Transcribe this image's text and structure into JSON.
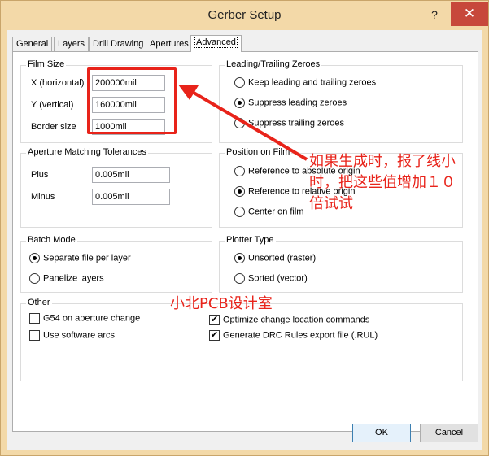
{
  "window": {
    "title": "Gerber Setup",
    "help_label": "?",
    "close_label": "✕"
  },
  "tabs": [
    {
      "label": "General"
    },
    {
      "label": "Layers"
    },
    {
      "label": "Drill Drawing"
    },
    {
      "label": "Apertures"
    },
    {
      "label": "Advanced"
    }
  ],
  "film_size": {
    "label": "Film Size",
    "x_label": "X (horizontal)",
    "x_value": "200000mil",
    "y_label": "Y (vertical)",
    "y_value": "160000mil",
    "border_label": "Border size",
    "border_value": "1000mil"
  },
  "zeroes": {
    "label": "Leading/Trailing Zeroes",
    "options": [
      {
        "label": "Keep leading and trailing zeroes",
        "checked": false
      },
      {
        "label": "Suppress leading zeroes",
        "checked": true
      },
      {
        "label": "Suppress trailing zeroes",
        "checked": false
      }
    ]
  },
  "aperture_tolerances": {
    "label": "Aperture Matching Tolerances",
    "plus_label": "Plus",
    "plus_value": "0.005mil",
    "minus_label": "Minus",
    "minus_value": "0.005mil"
  },
  "position": {
    "label": "Position on Film",
    "options": [
      {
        "label": "Reference to absolute origin",
        "checked": false
      },
      {
        "label": "Reference to relative origin",
        "checked": true
      },
      {
        "label": "Center on film",
        "checked": false
      }
    ]
  },
  "batch": {
    "label": "Batch Mode",
    "options": [
      {
        "label": "Separate file per layer",
        "checked": true
      },
      {
        "label": "Panelize layers",
        "checked": false
      }
    ]
  },
  "plotter": {
    "label": "Plotter Type",
    "options": [
      {
        "label": "Unsorted (raster)",
        "checked": true
      },
      {
        "label": "Sorted (vector)",
        "checked": false
      }
    ]
  },
  "other": {
    "label": "Other",
    "g54": {
      "label": "G54 on aperture change",
      "checked": false
    },
    "arcs": {
      "label": "Use software arcs",
      "checked": false
    },
    "optimize": {
      "label": "Optimize change location commands",
      "checked": true
    },
    "drc": {
      "label": "Generate DRC Rules export file (.RUL)",
      "checked": true
    }
  },
  "buttons": {
    "ok": "OK",
    "cancel": "Cancel"
  },
  "annotation": {
    "note_line1": "如果生成时，报了线小",
    "note_line2": "时，把这些值增加１０",
    "note_line3": "倍试试",
    "watermark": "小北PCB设计室",
    "color": "#e8231a"
  }
}
